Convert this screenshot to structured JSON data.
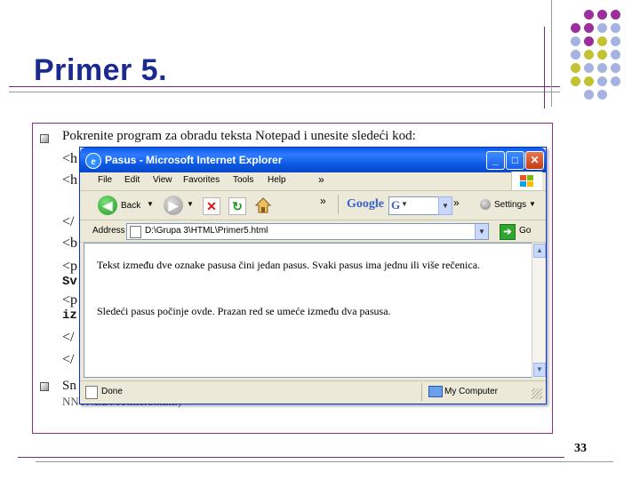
{
  "slide": {
    "title": "Primer 5.",
    "page_number": "33",
    "bullets": [
      {
        "text": "Pokrenite program za obradu teksta Notepad i unesite sledeći kod:"
      },
      {
        "text_visible_line1": "Sn",
        "text_visible_line2": "NNTNLDMTimer5.html)"
      }
    ],
    "code_fragments": [
      "<h",
      "<h",
      "</",
      "<b",
      "<p",
      "Sv",
      "<p",
      "iz",
      "</",
      "</"
    ]
  },
  "browser": {
    "window_title": "Pasus - Microsoft Internet Explorer",
    "menu": [
      "File",
      "Edit",
      "View",
      "Favorites",
      "Tools",
      "Help"
    ],
    "menu_overflow": "»",
    "toolbar": {
      "back_label": "Back",
      "toolbar_overflow": "»",
      "google_logo": "Google",
      "settings_label": "Settings"
    },
    "address": {
      "label": "Address",
      "url": "D:\\Grupa 3\\HTML\\Primer5.html",
      "go_label": "Go"
    },
    "page_content": {
      "paragraph1": "Tekst između dve oznake pasusa čini jedan pasus. Svaki pasus ima jednu ili više rečenica.",
      "paragraph2": "Sledeći pasus počinje ovde. Prazan red se umeće između dva pasusa."
    },
    "status": {
      "left": "Done",
      "zone": "My Computer"
    }
  },
  "colors": {
    "title_blue": "#1b2a8f",
    "frame_purple": "#8a2f8a",
    "ie_blue": "#0a5ae8",
    "dot_purple": "#9b2f9b",
    "dot_olive": "#c2c233",
    "dot_lavender": "#a6b2e0"
  }
}
